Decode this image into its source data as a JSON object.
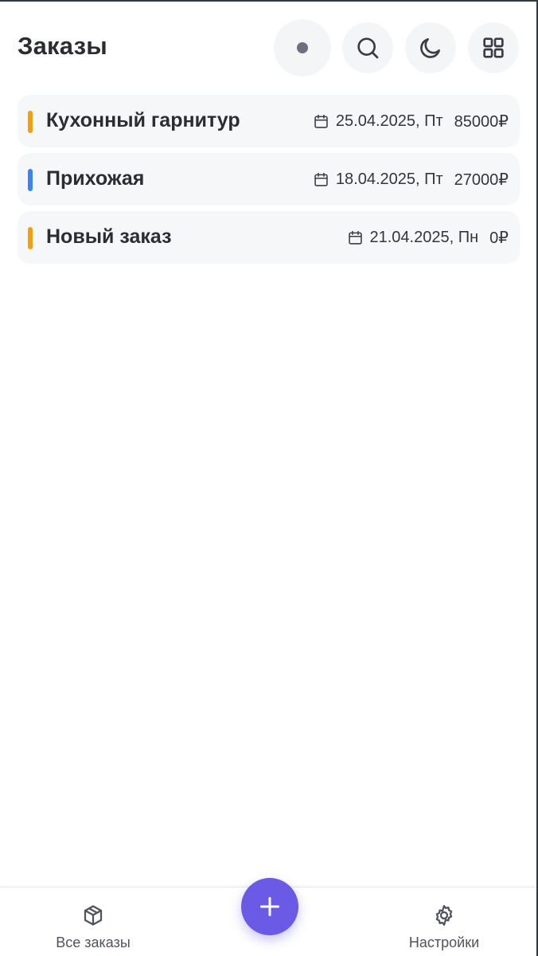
{
  "header": {
    "title": "Заказы",
    "buttons": {
      "status": "status-dot-icon",
      "search": "search-icon",
      "theme": "moon-icon",
      "layout": "grid-icon"
    }
  },
  "orders": [
    {
      "name": "Кухонный гарнитур",
      "date": "25.04.2025, Пт",
      "amount": "85000₽",
      "marker_color": "#f59e0b"
    },
    {
      "name": "Прихожая",
      "date": "18.04.2025, Пт",
      "amount": "27000₽",
      "marker_color": "#3b82f6"
    },
    {
      "name": "Новый заказ",
      "date": "21.04.2025, Пн",
      "amount": "0₽",
      "marker_color": "#f59e0b"
    }
  ],
  "bottom_nav": {
    "orders_label": "Все заказы",
    "settings_label": "Настройки",
    "add_icon": "plus-icon"
  },
  "colors": {
    "accent": "#6a5ae6",
    "card_bg": "#f6f7f9",
    "orange_marker": "#f59e0b",
    "blue_marker": "#3b82f6"
  }
}
